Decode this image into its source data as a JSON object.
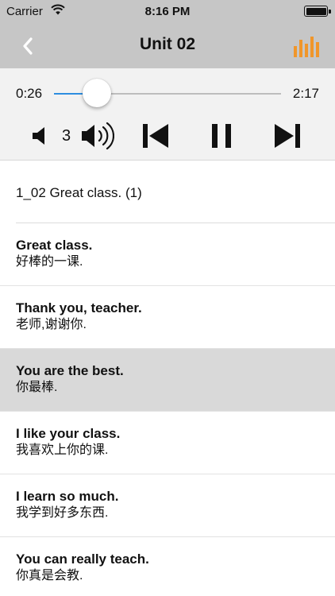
{
  "status": {
    "carrier": "Carrier",
    "time": "8:16 PM"
  },
  "nav": {
    "title": "Unit 02"
  },
  "player": {
    "current_time": "0:26",
    "total_time": "2:17",
    "progress_fraction": 0.19,
    "volume": "3"
  },
  "list": {
    "header": "1_02 Great class. (1)",
    "items": [
      {
        "en": "Great class.",
        "zh": "好棒的一课."
      },
      {
        "en": "Thank you, teacher.",
        "zh": "老师,谢谢你."
      },
      {
        "en": "You are the best.",
        "zh": "你最棒.",
        "selected": true
      },
      {
        "en": "I like your class.",
        "zh": "我喜欢上你的课."
      },
      {
        "en": "I learn so much.",
        "zh": "我学到好多东西."
      },
      {
        "en": "You can really teach.",
        "zh": "你真是会教."
      }
    ]
  },
  "colors": {
    "accent": "#2d8ee0",
    "eq_icon": "#f0962a",
    "bar_bg": "#c6c6c6",
    "selected_row": "#d9d9d9"
  },
  "icons": [
    "wifi-icon",
    "battery-icon",
    "back-chevron-icon",
    "equalizer-icon",
    "volume-down-icon",
    "volume-up-icon",
    "previous-track-icon",
    "pause-icon",
    "next-track-icon"
  ]
}
